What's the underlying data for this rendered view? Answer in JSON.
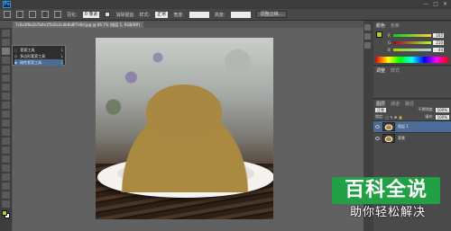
{
  "app": {
    "logo_text": "Ps"
  },
  "window_controls": [
    "—",
    "□",
    "✕"
  ],
  "options_bar": {
    "feather_label": "羽化:",
    "feather_value": "0 像素",
    "antialias_label": "消除锯齿",
    "style_label": "样式:",
    "style_value": "正常",
    "width_label": "宽度:",
    "width_value": "",
    "height_label": "高度:",
    "height_value": "",
    "refine_button": "调整边缘..."
  },
  "document_tab": "7c6a3f8a2b7b0a1f5d2e3c4b9a8f7e6d.jpg @ 66.7% (图层 1, RGB/8#)",
  "tool_flyout": {
    "items": [
      {
        "label": "套索工具",
        "shortcut": "L",
        "selected": false
      },
      {
        "label": "多边形套索工具",
        "shortcut": "L",
        "selected": false
      },
      {
        "label": "磁性套索工具",
        "shortcut": "L",
        "selected": true
      }
    ]
  },
  "color_panel": {
    "tabs": [
      "颜色",
      "色板"
    ],
    "channels": [
      {
        "name": "R",
        "value": "165"
      },
      {
        "name": "G",
        "value": "210"
      },
      {
        "name": "B",
        "value": "44"
      }
    ],
    "foreground_color": "#a5d22c",
    "background_color": "#ffffff"
  },
  "adjust_panel": {
    "tabs": [
      "调整",
      "样式"
    ]
  },
  "layers_panel": {
    "tabs": [
      "图层",
      "通道",
      "路径"
    ],
    "blend_mode": "正常",
    "opacity_label": "不透明度:",
    "opacity_value": "100%",
    "lock_label": "锁定:",
    "fill_label": "填充:",
    "fill_value": "100%",
    "layers": [
      {
        "name": "图层 1",
        "selected": true
      },
      {
        "name": "背景",
        "selected": false
      }
    ]
  },
  "watermark": {
    "logo_text": "百科全说",
    "subtitle": "助你轻松解决"
  }
}
